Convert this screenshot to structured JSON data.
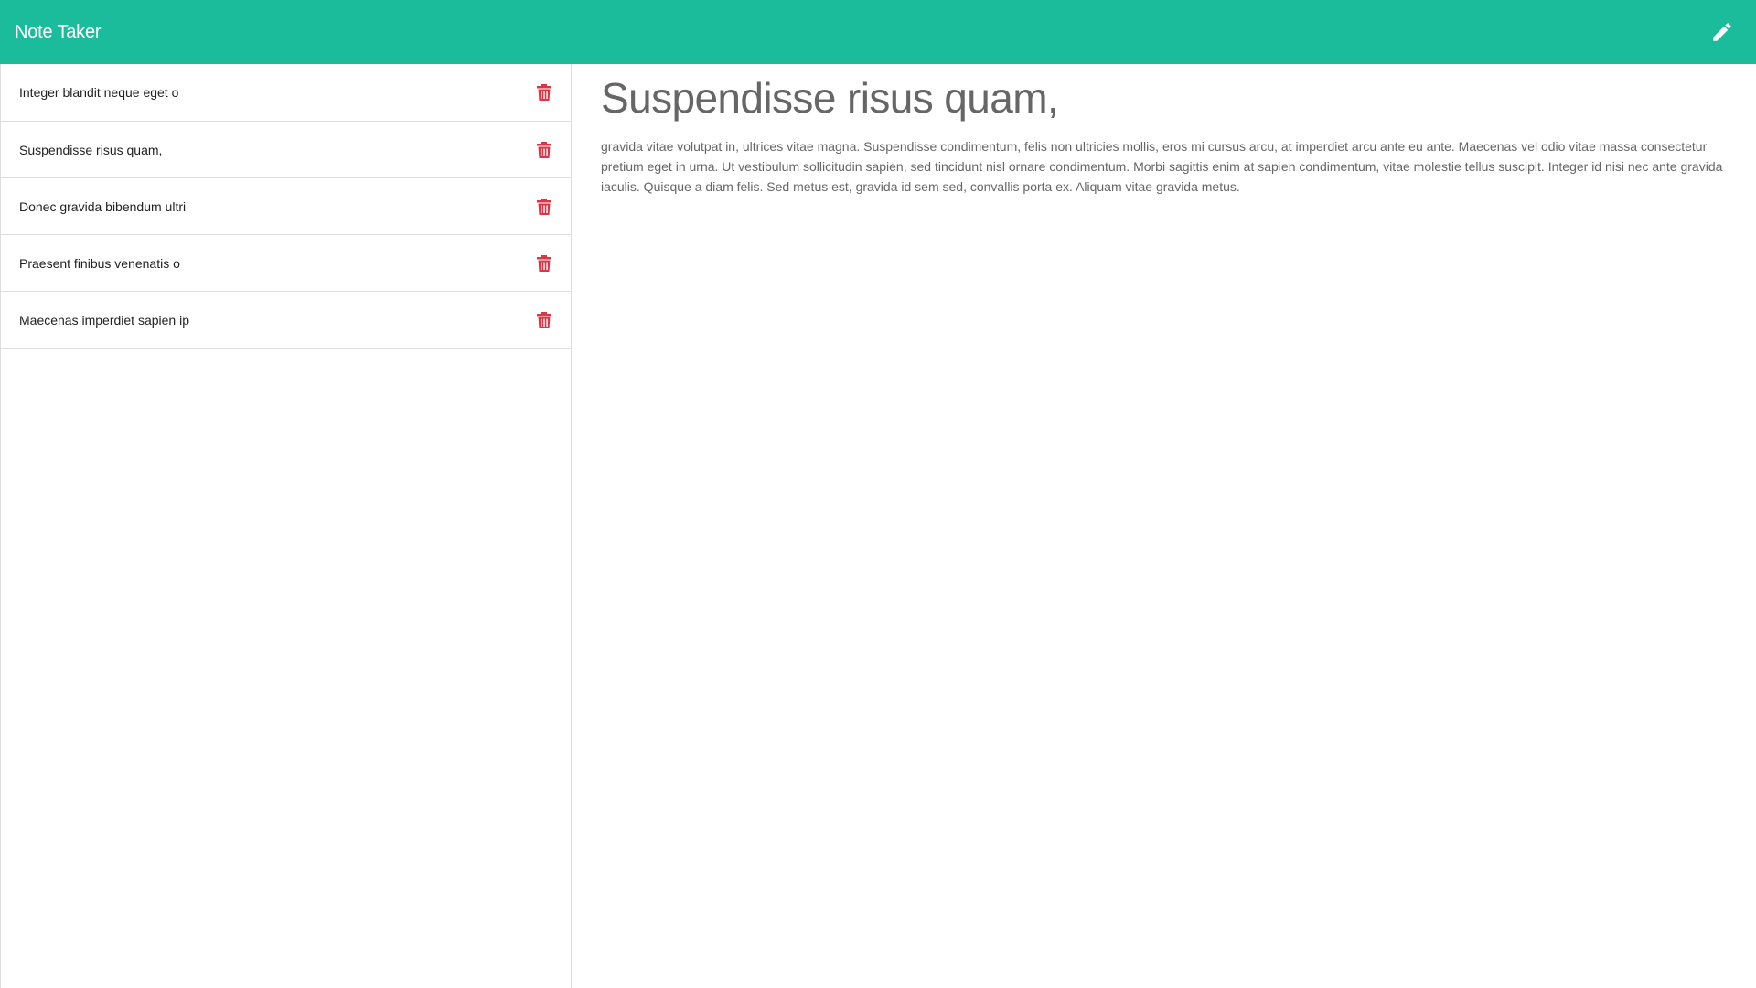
{
  "navbar": {
    "title": "Note Taker",
    "new_note_icon": "pencil-icon"
  },
  "notes": [
    {
      "title": "Integer blandit neque eget o",
      "delete_icon": "trash-icon"
    },
    {
      "title": "Suspendisse risus quam,",
      "delete_icon": "trash-icon"
    },
    {
      "title": "Donec gravida bibendum ultri",
      "delete_icon": "trash-icon"
    },
    {
      "title": "Praesent finibus venenatis o",
      "delete_icon": "trash-icon"
    },
    {
      "title": "Maecenas imperdiet sapien ip",
      "delete_icon": "trash-icon"
    }
  ],
  "active_note": {
    "title": "Suspendisse risus quam,",
    "text": "gravida vitae volutpat in, ultrices vitae magna. Suspendisse condimentum, felis non ultricies mollis, eros mi cursus arcu, at imperdiet arcu ante eu ante. Maecenas vel odio vitae massa consectetur pretium eget in urna. Ut vestibulum sollicitudin sapien, sed tincidunt nisl ornare condimentum. Morbi sagittis enim at sapien condimentum, vitae molestie tellus suscipit. Integer id nisi nec ante gravida iaculis. Quisque a diam felis. Sed metus est, gravida id sem sed, convallis porta ex. Aliquam vitae gravida metus."
  },
  "colors": {
    "navbar": "#1abc9c",
    "delete_icon": "#dc3545",
    "heading_text": "#666666"
  }
}
